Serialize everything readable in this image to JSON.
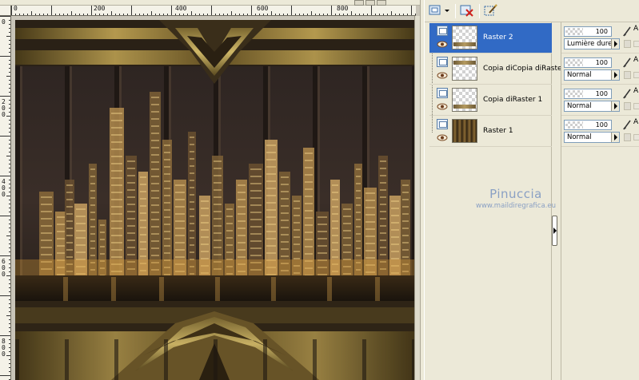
{
  "canvas": {
    "ruler_top_labels": [
      "0",
      "200",
      "400",
      "600",
      "800"
    ],
    "ruler_left_labels": [
      "0",
      "200",
      "400",
      "600",
      "800"
    ]
  },
  "toolbar": {
    "icons": [
      "new-layer-icon",
      "dropdown-arrow-icon",
      "delete-layer-icon",
      "layer-properties-icon"
    ]
  },
  "layers": [
    {
      "name": "Raster 2",
      "selected": true,
      "thumb": "band-top"
    },
    {
      "name": "Copia diCopia diRaster",
      "selected": false,
      "thumb": "band-middle"
    },
    {
      "name": "Copia diRaster 1",
      "selected": false,
      "thumb": "band-bottom"
    },
    {
      "name": "Raster 1",
      "selected": false,
      "thumb": "raster"
    }
  ],
  "properties": [
    {
      "opacity": "100",
      "blend_mode": "Lumière dure",
      "link_letter": "A"
    },
    {
      "opacity": "100",
      "blend_mode": "Normal",
      "link_letter": "A"
    },
    {
      "opacity": "100",
      "blend_mode": "Normal",
      "link_letter": "A"
    },
    {
      "opacity": "100",
      "blend_mode": "Normal",
      "link_letter": "A"
    }
  ],
  "watermark": {
    "title": "Pinuccia",
    "url": "www.maildiregrafica.eu"
  },
  "colors": {
    "selection": "#316ac5",
    "panel_bg": "#ece9d8",
    "watermark": "#8aa0c4"
  }
}
